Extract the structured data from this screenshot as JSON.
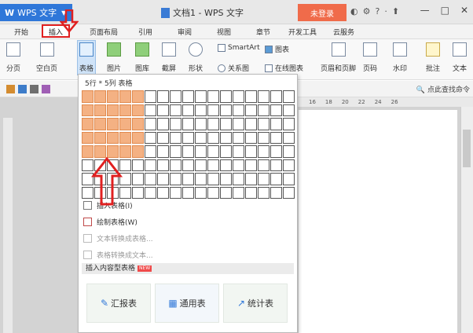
{
  "titlebar": {
    "app_name": "WPS 文字",
    "doc_title": "文档1 - WPS 文字",
    "login": "未登录",
    "help": "?"
  },
  "menu": [
    "开始",
    "插入",
    "页面布局",
    "引用",
    "审阅",
    "视图",
    "章节",
    "开发工具",
    "云服务"
  ],
  "toolbar": {
    "page_break": "分页",
    "blank_page": "空白页",
    "table": "表格",
    "picture": "图片",
    "gallery": "图库",
    "screenshot": "截屏",
    "shape": "形状",
    "smartart": "SmartArt",
    "relation": "关系图",
    "chart": "图表",
    "online_chart": "在线图表",
    "header_footer": "页眉和页脚",
    "page_number": "页码",
    "watermark": "水印",
    "comment": "批注",
    "textbox": "文本"
  },
  "search": "点此查找命令",
  "ruler_ticks": [
    "16",
    "18",
    "20",
    "22",
    "24",
    "26"
  ],
  "popup": {
    "header": "5行 * 5列 表格",
    "options": {
      "insert_table": "插入表格(I)",
      "draw_table": "绘制表格(W)",
      "text_to_table": "文本转换成表格...",
      "table_to_text": "表格转换成文本..."
    },
    "section": "插入内容型表格",
    "badge": "NEW",
    "cards": [
      "汇报表",
      "通用表",
      "统计表"
    ]
  },
  "grid": {
    "rows": 8,
    "cols": 17,
    "highlight_rows": 5,
    "highlight_cols": 5
  },
  "colors": {
    "accent": "#2f77d9",
    "highlight": "#f4b183",
    "annotation": "#e02020",
    "login": "#f06b4a"
  }
}
